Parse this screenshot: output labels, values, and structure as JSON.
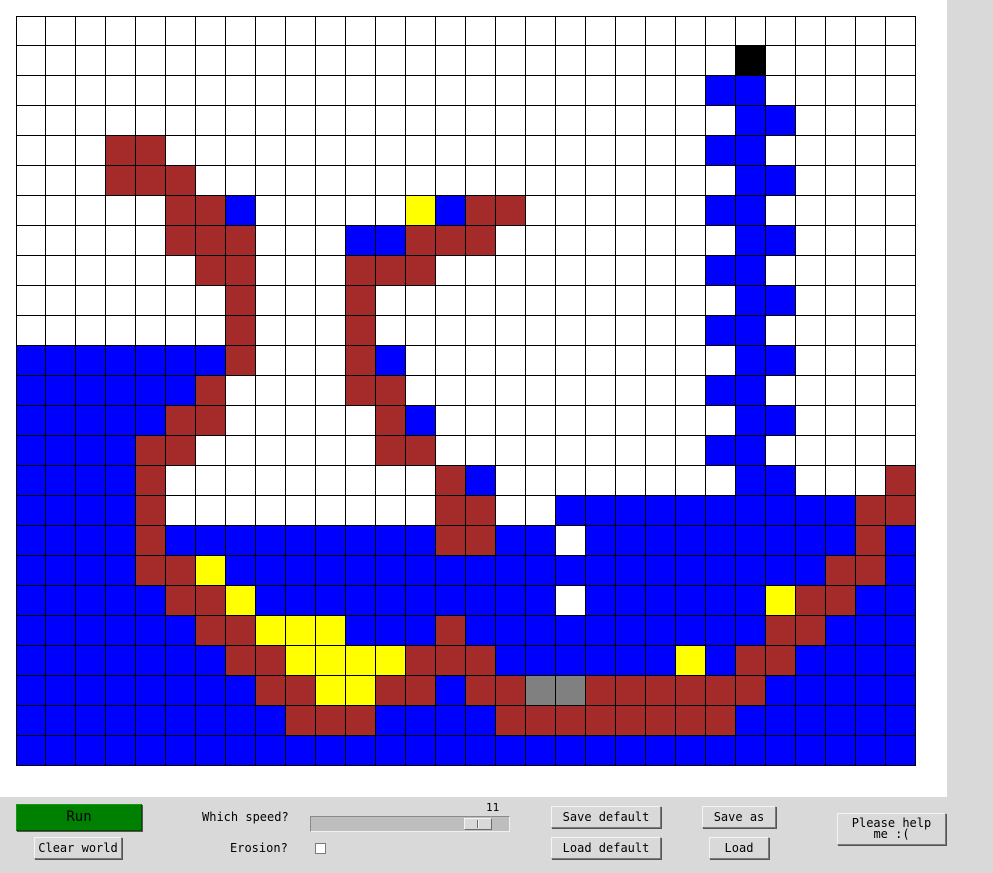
{
  "controls": {
    "run_label": "Run",
    "clear_label": "Clear world",
    "speed_label": "Which speed?",
    "speed_value": "11",
    "speed_fraction": 0.9,
    "erosion_label": "Erosion?",
    "erosion_checked": false,
    "save_default_label": "Save default",
    "load_default_label": "Load default",
    "save_as_label": "Save as",
    "load_label": "Load",
    "help_label": "Please help me :("
  },
  "colors": {
    "W": "#ffffff",
    "B": "#0000ff",
    "R": "#a52a2a",
    "Y": "#ffff00",
    "K": "#000000",
    "G": "#808080",
    "run_button": "#008000",
    "panel": "#d9d9d9"
  },
  "world": {
    "columns": 30,
    "rows": 25,
    "cells": [
      "WWWWWWWWWWWWWWWWWWWWWWWWWWWWWW",
      "WWWWWWWWWWWWWWWWWWWWWWWWKWWWWW",
      "WWWWWWWWWWWWWWWWWWWWWWWBBWWWWW",
      "WWWWWWWWWWWWWWWWWWWWWWWWBBWWWW",
      "WWWRRWWWWWWWWWWWWWWWWWWBBWWWWW",
      "WWWRRRWWWWWWWWWWWWWWWWWWBBWWWW",
      "WWWWWRRBWWWWWYBRRWWWWWWBBWWWWW",
      "WWWWWRRRWWWBBRRRWWWWWWWWBBWWWW",
      "WWWWWWRRWWWRRRWWWWWWWWWBBWWWWW",
      "WWWWWWWRWWWRWWWWWWWWWWWWBBWWWW",
      "WWWWWWWRWWWRWWWWWWWWWWWBBWWWWW",
      "BBBBBBBRWWWRBWWWWWWWWWWWBBWWWW",
      "BBBBBBRWWWWRRWWWWWWWWWWBBWWWWW",
      "BBBBBRRWWWWWRBWWWWWWWWWWBBWWWW",
      "BBBBRRWWWWWWRRWWWWWWWWWBBWWWWW",
      "BBBBRWWWWWWWWWRBWWWWWWWWBBWWWR",
      "BBBBRWWWWWWWWWRRWWBBBBBBBBBBRR",
      "BBBBRBBBBBBBBBRRBBWBBBBBBBBBRB",
      "BBBBRRYBBBBBBBBBBBBBBBBBBBBRRB",
      "BBBBBRRYBBBBBBBBBBWBBBBBBYRRBB",
      "BBBBBBRRYYYBBBRBBBBBBBBBBRRBBB",
      "BBBBBBBRRYYYYRRRBBBBBBYBRRBBBB",
      "BBBBBBBBRRYYRRBRRGGRRRRRRBBBBB",
      "BBBBBBBBBRRRBBBBRRRRRRRRBBBBBB",
      "BBBBBBBBBBBBBBBBBBBBBBBBBBBBBB"
    ]
  }
}
